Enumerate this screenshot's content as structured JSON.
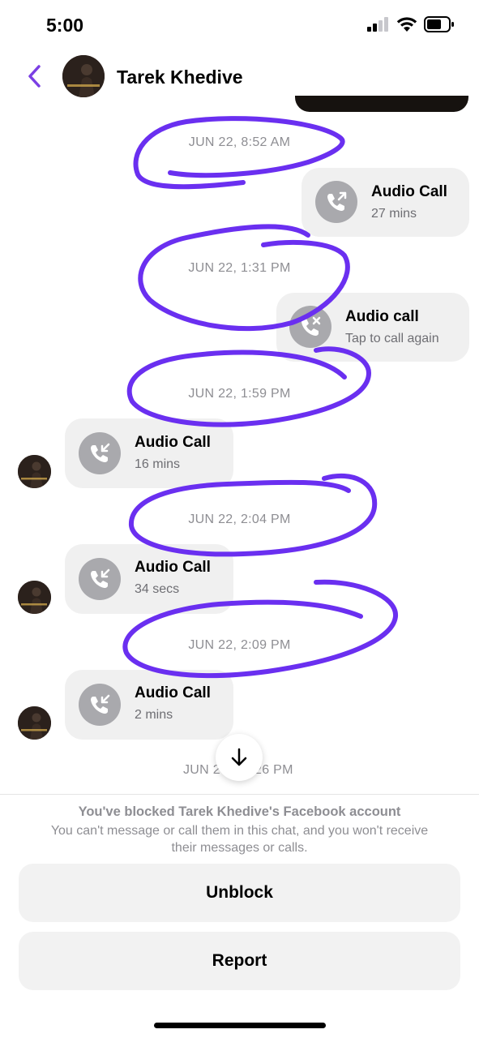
{
  "status_bar": {
    "time": "5:00",
    "icons": [
      "signal-icon",
      "wifi-icon",
      "battery-icon"
    ]
  },
  "header": {
    "back_icon": "chevron-left-icon",
    "contact_name": "Tarek Khedive",
    "accent": "#7b3fe4"
  },
  "messages": [
    {
      "timestamp": "JUN 22, 8:52 AM",
      "direction": "outgoing",
      "title": "Audio Call",
      "subtitle": "27 mins",
      "icon": "outgoing-call-icon"
    },
    {
      "timestamp": "JUN 22, 1:31 PM",
      "direction": "outgoing",
      "title": "Audio call",
      "subtitle": "Tap to call again",
      "icon": "missed-call-icon"
    },
    {
      "timestamp": "JUN 22, 1:59 PM",
      "direction": "incoming",
      "title": "Audio Call",
      "subtitle": "16 mins",
      "icon": "incoming-call-icon"
    },
    {
      "timestamp": "JUN 22, 2:04 PM",
      "direction": "incoming",
      "title": "Audio Call",
      "subtitle": "34 secs",
      "icon": "incoming-call-icon"
    },
    {
      "timestamp": "JUN 22, 2:09 PM",
      "direction": "incoming",
      "title": "Audio Call",
      "subtitle": "2 mins",
      "icon": "incoming-call-icon"
    }
  ],
  "partial_timestamp": {
    "left": "JUN 2",
    "right": "26 PM"
  },
  "scroll_button_icon": "arrow-down-icon",
  "blocked": {
    "title": "You've blocked Tarek Khedive's Facebook account",
    "description": "You can't message or call them in this chat, and you won't receive their messages or calls."
  },
  "buttons": {
    "unblock": "Unblock",
    "report": "Report"
  },
  "annotation_color": "#6a2ff0"
}
